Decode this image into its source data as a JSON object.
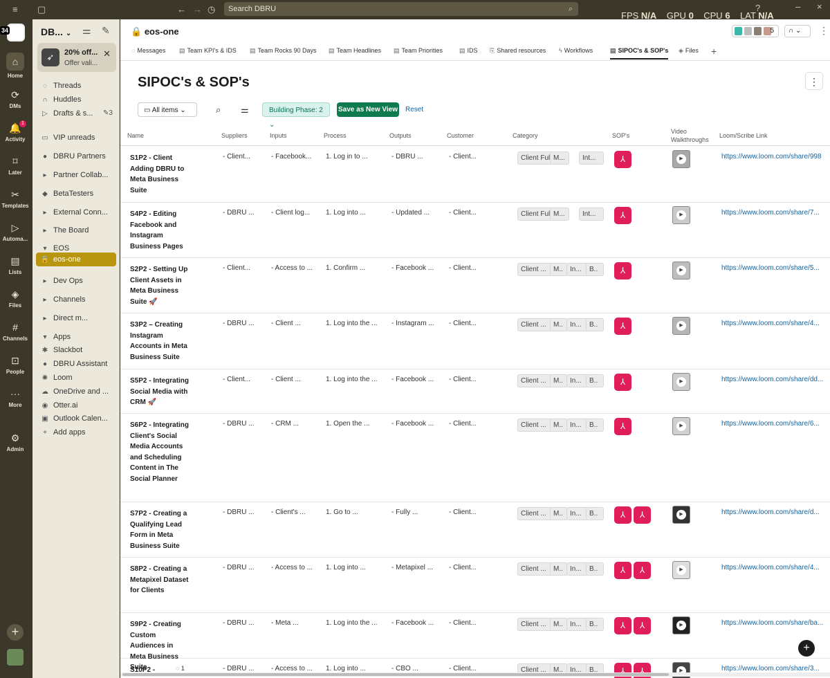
{
  "topbar": {
    "search_placeholder": "Search DBRU",
    "perf": [
      "FPS",
      "N/A",
      "GPU",
      "0",
      "CPU",
      "6",
      "LAT",
      "N/A"
    ]
  },
  "rail": {
    "workspace_badge": "34",
    "items": [
      {
        "label": "Home",
        "icon": "home-icon"
      },
      {
        "label": "DMs",
        "icon": "dm-icon"
      },
      {
        "label": "Activity",
        "icon": "bell-icon",
        "badge": "1"
      },
      {
        "label": "Later",
        "icon": "bookmark-icon"
      },
      {
        "label": "Templates",
        "icon": "templates-icon"
      },
      {
        "label": "Automa...",
        "icon": "automation-icon"
      },
      {
        "label": "Lists",
        "icon": "lists-icon"
      },
      {
        "label": "Files",
        "icon": "files-icon"
      },
      {
        "label": "Channels",
        "icon": "hash-icon"
      },
      {
        "label": "People",
        "icon": "people-icon"
      },
      {
        "label": "More",
        "icon": "more-icon"
      },
      {
        "label": "Admin",
        "icon": "gear-icon"
      }
    ]
  },
  "sidebar": {
    "workspace_name": "DB...",
    "promo": {
      "title": "20% off...",
      "subtitle": "Offer vali..."
    },
    "items": [
      {
        "label": "Threads",
        "icon": "threads-icon",
        "glyph": "◌"
      },
      {
        "label": "Huddles",
        "icon": "headphones-icon",
        "glyph": "∩"
      },
      {
        "label": "Drafts & s...",
        "icon": "send-icon",
        "glyph": "▷",
        "count": "✎3"
      },
      {
        "label": "VIP unreads",
        "icon": "vip-icon",
        "glyph": "▭"
      },
      {
        "label": "DBRU Partners",
        "icon": "emoji-icon",
        "glyph": "●"
      },
      {
        "label": "Partner Collab...",
        "icon": "caret-right-icon",
        "glyph": "▸"
      },
      {
        "label": "BetaTesters",
        "icon": "alien-icon",
        "glyph": "◆"
      },
      {
        "label": "External Conn...",
        "icon": "caret-right-icon",
        "glyph": "▸"
      },
      {
        "label": "The Board",
        "icon": "caret-right-icon",
        "glyph": "▸"
      },
      {
        "label": "EOS",
        "icon": "caret-down-icon",
        "glyph": "▾"
      },
      {
        "label": "eos-one",
        "icon": "lock-icon",
        "glyph": "🔒",
        "active": true
      },
      {
        "label": "Dev Ops",
        "icon": "caret-right-icon",
        "glyph": "▸"
      },
      {
        "label": "Channels",
        "icon": "caret-right-icon",
        "glyph": "▸"
      },
      {
        "label": "Direct m...",
        "icon": "caret-right-icon",
        "glyph": "▸"
      },
      {
        "label": "Apps",
        "icon": "caret-down-icon",
        "glyph": "▾"
      },
      {
        "label": "Slackbot",
        "icon": "slackbot-icon",
        "glyph": "✱"
      },
      {
        "label": "DBRU Assistant",
        "icon": "assistant-icon",
        "glyph": "●"
      },
      {
        "label": "Loom",
        "icon": "loom-icon",
        "glyph": "✺"
      },
      {
        "label": "OneDrive and ...",
        "icon": "onedrive-icon",
        "glyph": "☁"
      },
      {
        "label": "Otter.ai",
        "icon": "otter-icon",
        "glyph": "◉"
      },
      {
        "label": "Outlook Calen...",
        "icon": "outlook-icon",
        "glyph": "▣"
      },
      {
        "label": "Add apps",
        "icon": "plus-icon",
        "glyph": "+"
      }
    ]
  },
  "header": {
    "channel": "eos-one",
    "members_count": "5"
  },
  "tabs": [
    {
      "label": "Messages",
      "icon": "messages-icon"
    },
    {
      "label": "Team KPI's & IDS",
      "icon": "list-icon"
    },
    {
      "label": "Team Rocks 90 Days",
      "icon": "list-icon"
    },
    {
      "label": "Team Headlines",
      "icon": "list-icon"
    },
    {
      "label": "Team Priorities",
      "icon": "list-icon"
    },
    {
      "label": "IDS",
      "icon": "list-icon"
    },
    {
      "label": "Shared resources",
      "icon": "canvas-icon"
    },
    {
      "label": "Workflows",
      "icon": "workflow-icon"
    },
    {
      "label": "SIPOC's & SOP's",
      "icon": "list-icon",
      "active": true
    },
    {
      "label": "Files",
      "icon": "files-icon"
    }
  ],
  "page": {
    "title": "SIPOC's & SOP's"
  },
  "toolbar": {
    "all_items": "All items",
    "filter_chip": "Building Phase: 2",
    "save_view": "Save as New View",
    "reset": "Reset"
  },
  "columns": [
    "Name",
    "Suppliers",
    "Inputs",
    "Process",
    "Outputs",
    "Customer",
    "Category",
    "SOP's",
    "Video Walkthroughs",
    "Loom/Scribe Link"
  ],
  "rows": [
    {
      "name": "S1P2 - Client Adding DBRU to Meta Business Suite",
      "suppliers": "- Client...",
      "inputs": "- Facebook...",
      "process": "1. Log in to ...",
      "outputs": "- DBRU ...",
      "customer": "- Client...",
      "categories": [
        "Client Ful...",
        "M...",
        "Int..."
      ],
      "sops": 1,
      "link": "https://www.loom.com/share/998"
    },
    {
      "name": "S4P2 - Editing Facebook and Instagram Business Pages",
      "suppliers": "- DBRU ...",
      "inputs": "- Client log...",
      "process": "1. Log into ...",
      "outputs": "- Updated ...",
      "customer": "- Client...",
      "categories": [
        "Client Ful...",
        "M...",
        "Int..."
      ],
      "sops": 1,
      "link": "https://www.loom.com/share/7..."
    },
    {
      "name": "S2P2 - Setting Up Client Assets in Meta Business Suite 🚀",
      "suppliers": "- Client...",
      "inputs": "- Access to ...",
      "process": "1. Confirm ...",
      "outputs": "- Facebook ...",
      "customer": "- Client...",
      "categories": [
        "Client ...",
        "M..",
        "In...",
        "B.."
      ],
      "sops": 1,
      "link": "https://www.loom.com/share/5..."
    },
    {
      "name": "S3P2 – Creating Instagram Accounts in Meta Business Suite",
      "suppliers": "- DBRU ...",
      "inputs": "- Client ...",
      "process": "1. Log into the ...",
      "outputs": "- Instagram ...",
      "customer": "- Client...",
      "categories": [
        "Client ...",
        "M..",
        "In...",
        "B.."
      ],
      "sops": 1,
      "link": "https://www.loom.com/share/4..."
    },
    {
      "name": "S5P2 - Integrating Social Media with CRM 🚀",
      "suppliers": "- Client...",
      "inputs": "- Client ...",
      "process": "1. Log into the ...",
      "outputs": "- Facebook ...",
      "customer": "- Client...",
      "categories": [
        "Client ...",
        "M..",
        "In...",
        "B.."
      ],
      "sops": 1,
      "link": "https://www.loom.com/share/dd..."
    },
    {
      "name": "S6P2 - Integrating Client's Social Media Accounts and Scheduling Content in The Social Planner",
      "suppliers": "- DBRU ...",
      "inputs": "- CRM ...",
      "process": "1. Open the ...",
      "outputs": "- Facebook ...",
      "customer": "- Client...",
      "categories": [
        "Client ...",
        "M..",
        "In...",
        "B.."
      ],
      "sops": 1,
      "link": "https://www.loom.com/share/6..."
    },
    {
      "name": "S7P2 - Creating a Qualifying Lead Form in Meta Business Suite",
      "suppliers": "- DBRU ...",
      "inputs": "- Client's ...",
      "process": "1. Go to ...",
      "outputs": "- Fully ...",
      "customer": "- Client...",
      "categories": [
        "Client ...",
        "M..",
        "In...",
        "B.."
      ],
      "sops": 2,
      "link": "https://www.loom.com/share/d..."
    },
    {
      "name": "S8P2 - Creating a Metapixel Dataset for Clients",
      "suppliers": "- DBRU ...",
      "inputs": "- Access to ...",
      "process": "1. Log into ...",
      "outputs": "- Metapixel ...",
      "customer": "- Client...",
      "categories": [
        "Client ...",
        "M..",
        "In...",
        "B.."
      ],
      "sops": 2,
      "link": "https://www.loom.com/share/4..."
    },
    {
      "name": "S9P2 - Creating Custom Audiences in Meta Business Suite",
      "suppliers": "- DBRU ...",
      "inputs": "- Meta ...",
      "process": "1. Log into the ...",
      "outputs": "- Facebook ...",
      "customer": "- Client...",
      "categories": [
        "Client ...",
        "M..",
        "In...",
        "B.."
      ],
      "sops": 2,
      "link": "https://www.loom.com/share/ba..."
    },
    {
      "name": "S10P2 -",
      "comments": "1",
      "suppliers": "- DBRU ...",
      "inputs": "- Access to ...",
      "process": "1. Log into ...",
      "outputs": "- CBO ...",
      "customer": "- Client...",
      "categories": [
        "Client ...",
        "M..",
        "In...",
        "B.."
      ],
      "sops": 2,
      "link": "https://www.loom.com/share/3..."
    }
  ]
}
